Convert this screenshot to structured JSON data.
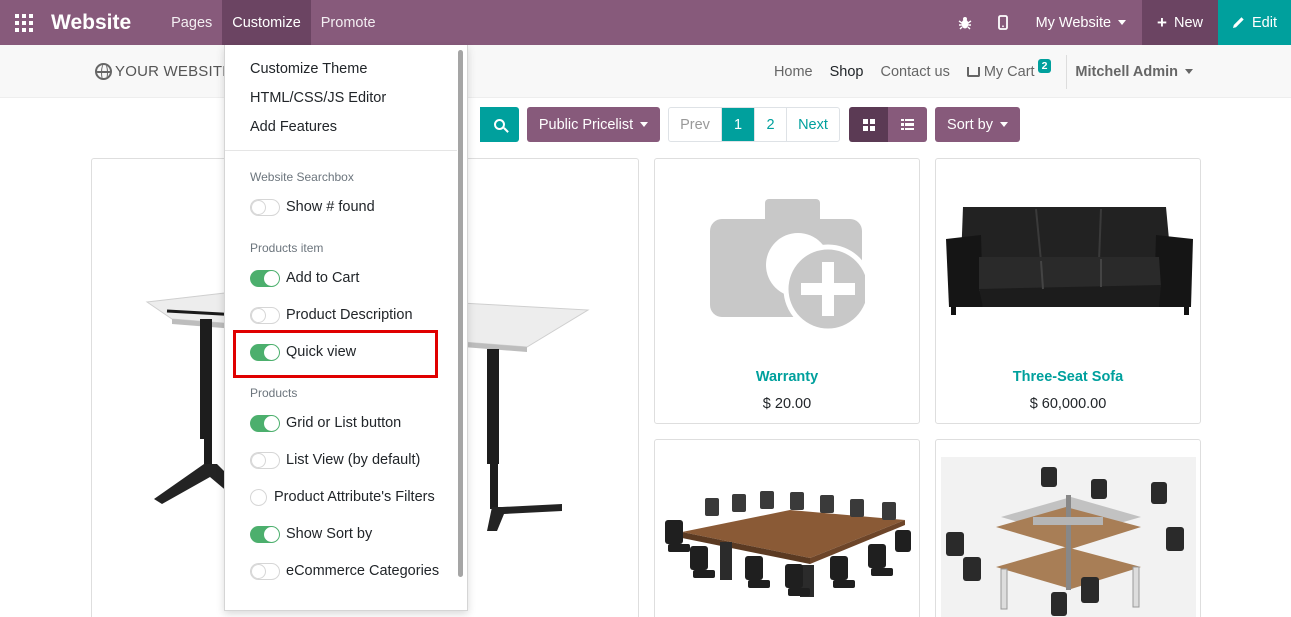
{
  "topbar": {
    "brand": "Website",
    "menus": [
      "Pages",
      "Customize",
      "Promote"
    ],
    "website_selector": "My Website",
    "new_label": "New",
    "edit_label": "Edit"
  },
  "site": {
    "logo": "YOUR WEBSITE",
    "nav": [
      "Home",
      "Shop",
      "Contact us"
    ],
    "cart_label": "My Cart",
    "cart_count": "2",
    "user": "Mitchell Admin"
  },
  "toolbar": {
    "pricelist": "Public Pricelist",
    "pager": {
      "prev": "Prev",
      "page1": "1",
      "page2": "2",
      "next": "Next"
    },
    "sort_by": "Sort by"
  },
  "customize_menu": {
    "items": [
      "Customize Theme",
      "HTML/CSS/JS Editor",
      "Add Features"
    ],
    "sections": [
      {
        "header": "Website Searchbox",
        "options": [
          {
            "label": "Show # found",
            "state": "off"
          }
        ]
      },
      {
        "header": "Products item",
        "options": [
          {
            "label": "Add to Cart",
            "state": "on"
          },
          {
            "label": "Product Description",
            "state": "off"
          },
          {
            "label": "Quick view",
            "state": "on"
          }
        ]
      },
      {
        "header": "Products",
        "options": [
          {
            "label": "Grid or List button",
            "state": "on"
          },
          {
            "label": "List View (by default)",
            "state": "off"
          },
          {
            "label": "Product Attribute's Filters",
            "state": "radio"
          },
          {
            "label": "Show Sort by",
            "state": "on"
          },
          {
            "label": "eCommerce Categories",
            "state": "off"
          }
        ]
      }
    ]
  },
  "products": [
    {
      "name": "Warranty",
      "price": "$ 20.00"
    },
    {
      "name": "Three-Seat Sofa",
      "price": "$ 60,000.00"
    }
  ],
  "colors": {
    "primary": "#875a7b",
    "accent": "#00a09d",
    "toggle_on": "#4caf6d",
    "highlight": "#e00000"
  }
}
